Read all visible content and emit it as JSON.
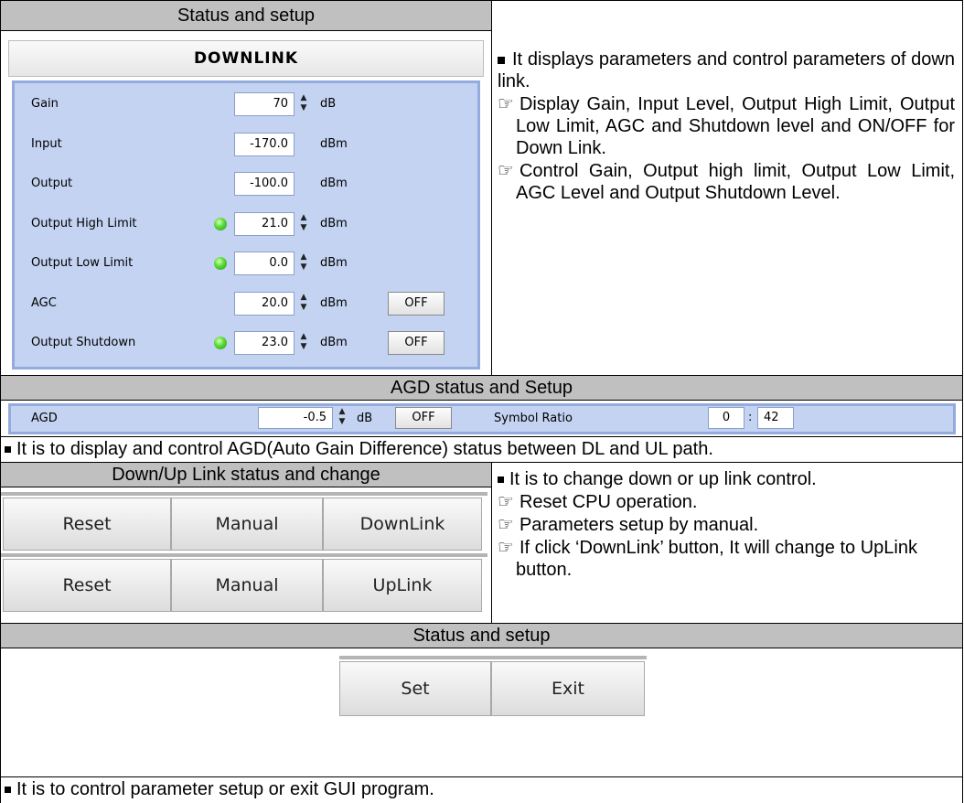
{
  "sections": {
    "status_setup_title": "Status and setup",
    "agd_title": "AGD status and Setup",
    "link_title": "Down/Up Link status and change",
    "status_setup2_title": "Status and setup"
  },
  "downlink": {
    "title": "DOWNLINK",
    "rows": [
      {
        "label": "Gain",
        "value": "70",
        "unit": "dB",
        "spinner": true,
        "led": false,
        "button": ""
      },
      {
        "label": "Input",
        "value": "-170.0",
        "unit": "dBm",
        "spinner": false,
        "led": false,
        "button": ""
      },
      {
        "label": "Output",
        "value": "-100.0",
        "unit": "dBm",
        "spinner": false,
        "led": false,
        "button": ""
      },
      {
        "label": "Output High Limit",
        "value": "21.0",
        "unit": "dBm",
        "spinner": true,
        "led": true,
        "button": ""
      },
      {
        "label": "Output Low Limit",
        "value": "0.0",
        "unit": "dBm",
        "spinner": true,
        "led": true,
        "button": ""
      },
      {
        "label": "AGC",
        "value": "20.0",
        "unit": "dBm",
        "spinner": true,
        "led": false,
        "button": "OFF"
      },
      {
        "label": "Output Shutdown",
        "value": "23.0",
        "unit": "dBm",
        "spinner": true,
        "led": true,
        "button": "OFF"
      }
    ],
    "led_color": "#55d933"
  },
  "downlink_desc": {
    "intro": "It displays parameters and control parameters of down link.",
    "items": [
      "Display Gain, Input Level, Output High Limit, Output Low Limit, AGC and Shutdown level and ON/OFF for Down Link.",
      "Control Gain, Output high limit, Output Low Limit, AGC Level and Output Shutdown Level."
    ]
  },
  "agd": {
    "label": "AGD",
    "value": "-0.5",
    "unit": "dB",
    "button": "OFF",
    "symbol_label": "Symbol Ratio",
    "symbol_a": "0",
    "symbol_sep": ":",
    "symbol_b": "42",
    "desc": "It is to display and control AGD(Auto Gain Difference) status between DL and UL path."
  },
  "link": {
    "row1": [
      "Reset",
      "Manual",
      "DownLink"
    ],
    "row2": [
      "Reset",
      "Manual",
      "UpLink"
    ],
    "intro": "It is to change down or up link control.",
    "items": [
      "Reset CPU operation.",
      "Parameters setup by manual.",
      "If click ‘DownLink’ button, It will change to UpLink button."
    ]
  },
  "final": {
    "set_label": "Set",
    "exit_label": "Exit",
    "desc": "It is to control parameter setup or exit GUI program."
  },
  "icons": {
    "bullet": "black-square-bullet-icon",
    "pointer": "pointing-hand-icon",
    "spinner": "spinner-arrows-icon",
    "led": "green-led-icon"
  },
  "colors": {
    "header_gray": "#c0c0c0",
    "panel_blue": "#c4d3f2",
    "panel_border": "#93acdd"
  }
}
